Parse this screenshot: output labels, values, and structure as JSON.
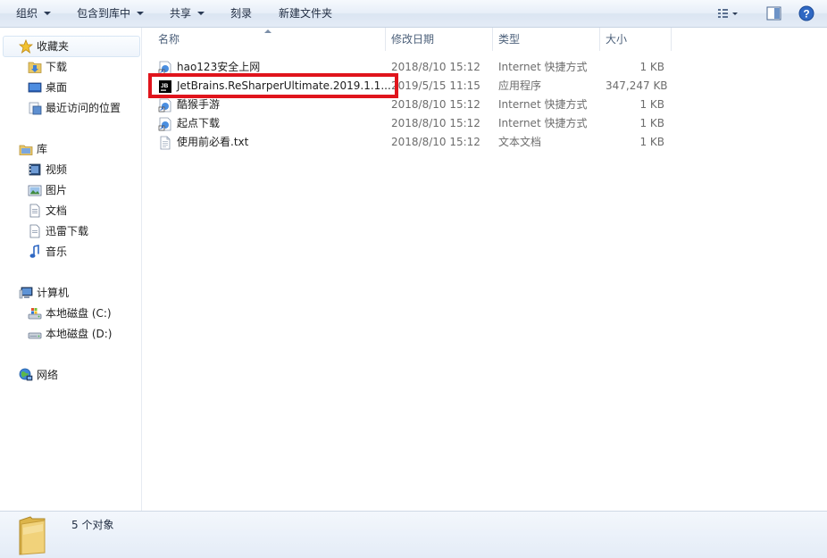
{
  "toolbar": {
    "organize": "组织",
    "include_in_library": "包含到库中",
    "share": "共享",
    "burn": "刻录",
    "new_folder": "新建文件夹"
  },
  "nav": {
    "favorites": {
      "label": "收藏夹",
      "items": [
        "下载",
        "桌面",
        "最近访问的位置"
      ]
    },
    "libraries": {
      "label": "库",
      "items": [
        "视频",
        "图片",
        "文档",
        "迅雷下载",
        "音乐"
      ]
    },
    "computer": {
      "label": "计算机",
      "items": [
        "本地磁盘 (C:)",
        "本地磁盘 (D:)"
      ]
    },
    "network": {
      "label": "网络"
    }
  },
  "columns": {
    "name": "名称",
    "date": "修改日期",
    "type": "类型",
    "size": "大小"
  },
  "files": [
    {
      "name": "hao123安全上网",
      "date": "2018/8/10 15:12",
      "type": "Internet 快捷方式",
      "size": "1 KB",
      "icon": "internet-shortcut-icon"
    },
    {
      "name": "JetBrains.ReSharperUltimate.2019.1.1...",
      "date": "2019/5/15 11:15",
      "type": "应用程序",
      "size": "347,247 KB",
      "icon": "jetbrains-app-icon"
    },
    {
      "name": "酷猴手游",
      "date": "2018/8/10 15:12",
      "type": "Internet 快捷方式",
      "size": "1 KB",
      "icon": "internet-shortcut-icon"
    },
    {
      "name": "起点下载",
      "date": "2018/8/10 15:12",
      "type": "Internet 快捷方式",
      "size": "1 KB",
      "icon": "internet-shortcut-icon"
    },
    {
      "name": "使用前必看.txt",
      "date": "2018/8/10 15:12",
      "type": "文本文档",
      "size": "1 KB",
      "icon": "text-file-icon"
    }
  ],
  "status": {
    "count": "5 个对象"
  },
  "colors": {
    "highlight": "#e0141c",
    "toolbar_bg": "#e3ebf6"
  }
}
